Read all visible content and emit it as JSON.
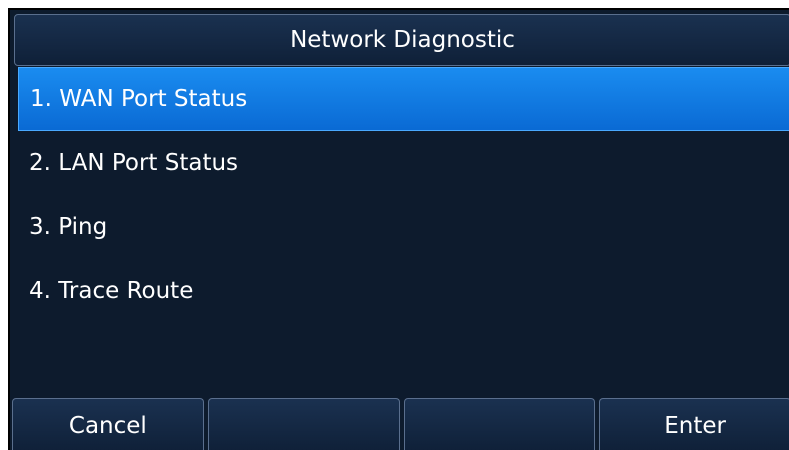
{
  "screen": {
    "title": "Network Diagnostic"
  },
  "menu": {
    "selected_index": 0,
    "items": [
      {
        "label": "1. WAN Port Status"
      },
      {
        "label": "2. LAN Port Status"
      },
      {
        "label": "3. Ping"
      },
      {
        "label": "4. Trace Route"
      }
    ]
  },
  "softkeys": [
    {
      "label": "Cancel"
    },
    {
      "label": ""
    },
    {
      "label": ""
    },
    {
      "label": "Enter"
    }
  ],
  "colors": {
    "background": "#0d1b2d",
    "selection": "#1a8cf0",
    "text": "#ffffff"
  }
}
